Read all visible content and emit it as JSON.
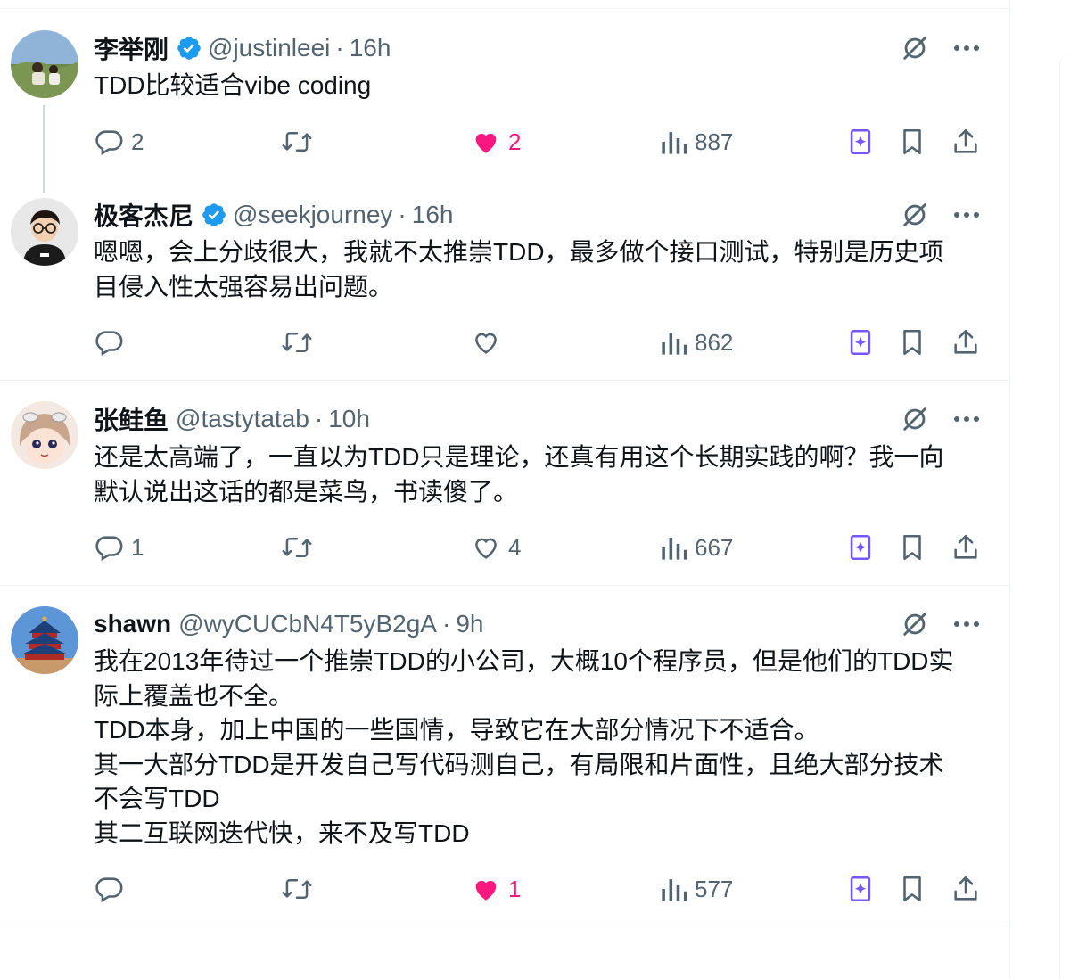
{
  "icons": {
    "verified": "verified-badge-icon",
    "grok": "grok-slash-icon",
    "more": "more-dots-icon",
    "reply": "reply-bubble-icon",
    "retweet": "retweet-icon",
    "like": "heart-icon",
    "views": "views-bar-chart-icon",
    "grok_summary": "grok-sparkle-icon",
    "bookmark": "bookmark-icon",
    "share": "share-icon"
  },
  "colors": {
    "accent": "#1d9bf0",
    "like": "#f91880",
    "muted": "#536471",
    "grok": "#7856ff"
  },
  "tweets": [
    {
      "name": "李举刚",
      "verified": true,
      "handle": "@justinleei",
      "sep": "·",
      "time": "16h",
      "text": "TDD比较适合vibe coding",
      "replies": "2",
      "retweets": "",
      "likes": "2",
      "liked": true,
      "views": "887"
    },
    {
      "name": "极客杰尼",
      "verified": true,
      "handle": "@seekjourney",
      "sep": "·",
      "time": "16h",
      "text": "嗯嗯，会上分歧很大，我就不太推崇TDD，最多做个接口测试，特别是历史项\n目侵入性太强容易出问题。",
      "replies": "",
      "retweets": "",
      "likes": "",
      "liked": false,
      "views": "862"
    },
    {
      "name": "张鲑鱼",
      "verified": false,
      "handle": "@tastytatab",
      "sep": "·",
      "time": "10h",
      "text": "还是太高端了，一直以为TDD只是理论，还真有用这个长期实践的啊？我一向\n默认说出这话的都是菜鸟，书读傻了。",
      "replies": "1",
      "retweets": "",
      "likes": "4",
      "liked": false,
      "views": "667"
    },
    {
      "name": "shawn",
      "verified": false,
      "handle": "@wyCUCbN4T5yB2gA",
      "sep": "·",
      "time": "9h",
      "text": "我在2013年待过一个推崇TDD的小公司，大概10个程序员，但是他们的TDD实\n际上覆盖也不全。\nTDD本身，加上中国的一些国情，导致它在大部分情况下不适合。\n其一大部分TDD是开发自己写代码测自己，有局限和片面性，且绝大部分技术\n不会写TDD\n其二互联网迭代快，来不及写TDD",
      "replies": "",
      "retweets": "",
      "likes": "1",
      "liked": true,
      "views": "577"
    }
  ]
}
